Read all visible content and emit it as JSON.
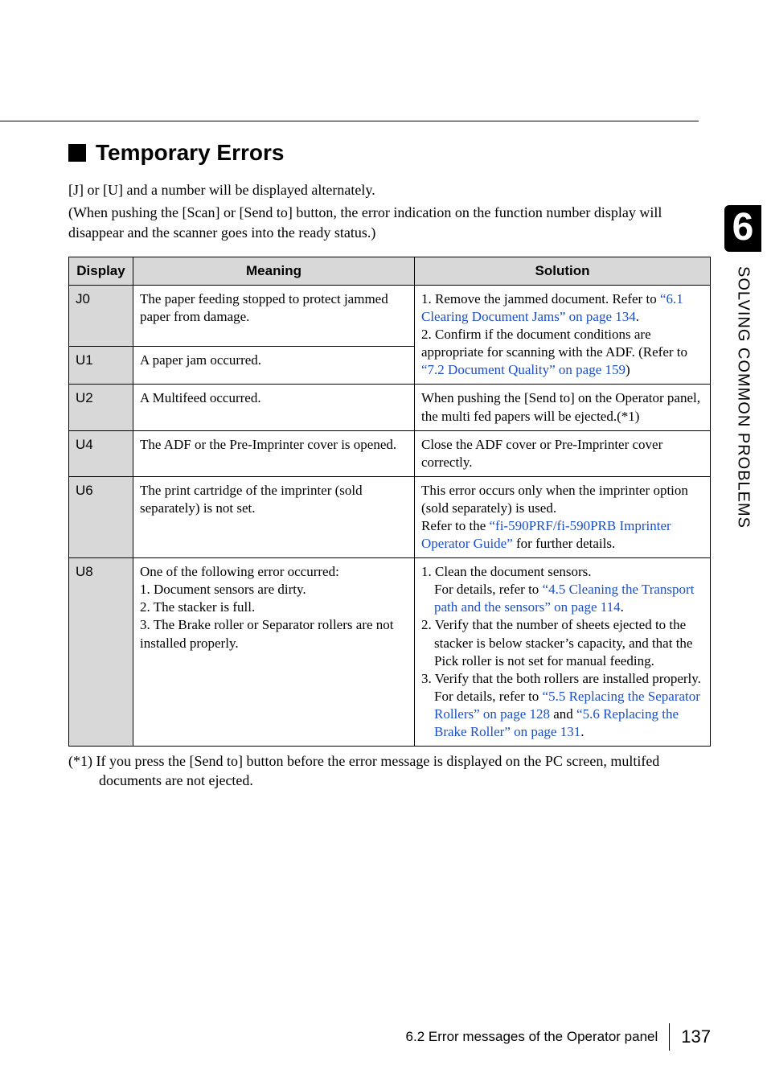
{
  "side": {
    "num": "6",
    "text": "SOLVING COMMON PROBLEMS"
  },
  "title": "Temporary Errors",
  "intro1": "[J] or [U] and a number will be displayed alternately.",
  "intro2": "(When pushing the [Scan] or [Send to] button, the error indication on the function number display will disappear and the scanner goes into the ready status.)",
  "headers": {
    "display": "Display",
    "meaning": "Meaning",
    "solution": "Solution"
  },
  "rows": {
    "j0": {
      "code": "J0",
      "meaning": "The paper feeding stopped to protect jammed paper from damage."
    },
    "u1": {
      "code": "U1",
      "meaning": "A paper jam occurred."
    },
    "sol_merge_a": "1. Remove the jammed document. Refer to ",
    "sol_merge_link1": "“6.1 Clearing Document Jams” on page 134",
    "sol_merge_b": ".",
    "sol_merge_c": "2. Confirm if the document conditions are appropriate for scanning with the ADF. (Refer to ",
    "sol_merge_link2": "“7.2 Document Quality” on page 159",
    "sol_merge_d": ")",
    "u2": {
      "code": "U2",
      "meaning": "A Multifeed occurred.",
      "solution": "When pushing the [Send to] on the Operator panel, the multi fed papers will be ejected.(*1)"
    },
    "u4": {
      "code": "U4",
      "meaning": "The ADF or the Pre-Imprinter cover is opened.",
      "solution": "Close the ADF cover or Pre-Imprinter cover correctly."
    },
    "u6": {
      "code": "U6",
      "meaning": "The print cartridge of the imprinter (sold separately) is not set.",
      "sol_a": "This error occurs only when the imprinter option (sold separately) is used.",
      "sol_b": "Refer to the ",
      "sol_link": "“fi-590PRF/fi-590PRB Imprinter Operator Guide”",
      "sol_c": " for further details."
    },
    "u8": {
      "code": "U8",
      "m1": "One of the following error occurred:",
      "m2": "1. Document sensors are dirty.",
      "m3": "2. The stacker is full.",
      "m4": "3. The Brake roller or Separator rollers are not installed properly.",
      "s1": "1. Clean the document sensors.",
      "s2a": "For details, refer to ",
      "s2link": "“4.5 Cleaning the Transport path and the sensors” on page 114",
      "s2b": ".",
      "s3": "2. Verify that the number of sheets ejected to the stacker is below stacker’s capacity, and that the Pick roller is not set for manual feeding.",
      "s4": "3. Verify that the both rollers are installed properly.",
      "s5a": "For details, refer to ",
      "s5link1": "“5.5 Replacing the Separator Rollers” on page 128",
      "s5mid": " and ",
      "s5link2": "“5.6 Replacing the Brake Roller” on page 131",
      "s5b": "."
    }
  },
  "footnote": "(*1) If you press the [Send to] button before the error message is displayed on the PC screen, multifed documents are not ejected.",
  "footer": {
    "text": "6.2 Error messages of the Operator panel",
    "page": "137"
  }
}
